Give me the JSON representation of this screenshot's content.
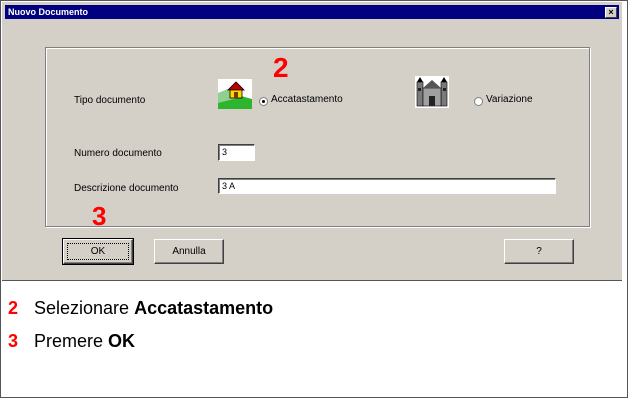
{
  "window": {
    "title": "Nuovo Documento",
    "close_glyph": "×"
  },
  "form": {
    "tipo_label": "Tipo documento",
    "option_accatastamento": {
      "label": "Accatastamento",
      "selected": true
    },
    "option_variazione": {
      "label": "Variazione",
      "selected": false
    },
    "numero_label": "Numero documento",
    "numero_value": "3",
    "descrizione_label": "Descrizione documento",
    "descrizione_value": "3 A"
  },
  "buttons": {
    "ok": "OK",
    "annulla": "Annulla",
    "help": "?"
  },
  "step_markers": {
    "two": "2",
    "three": "3"
  },
  "instructions": [
    {
      "num": "2",
      "text": "Selezionare ",
      "bold": "Accatastamento"
    },
    {
      "num": "3",
      "text": "Premere ",
      "bold": "OK"
    }
  ],
  "icons": [
    "house-icon",
    "building-icon"
  ]
}
